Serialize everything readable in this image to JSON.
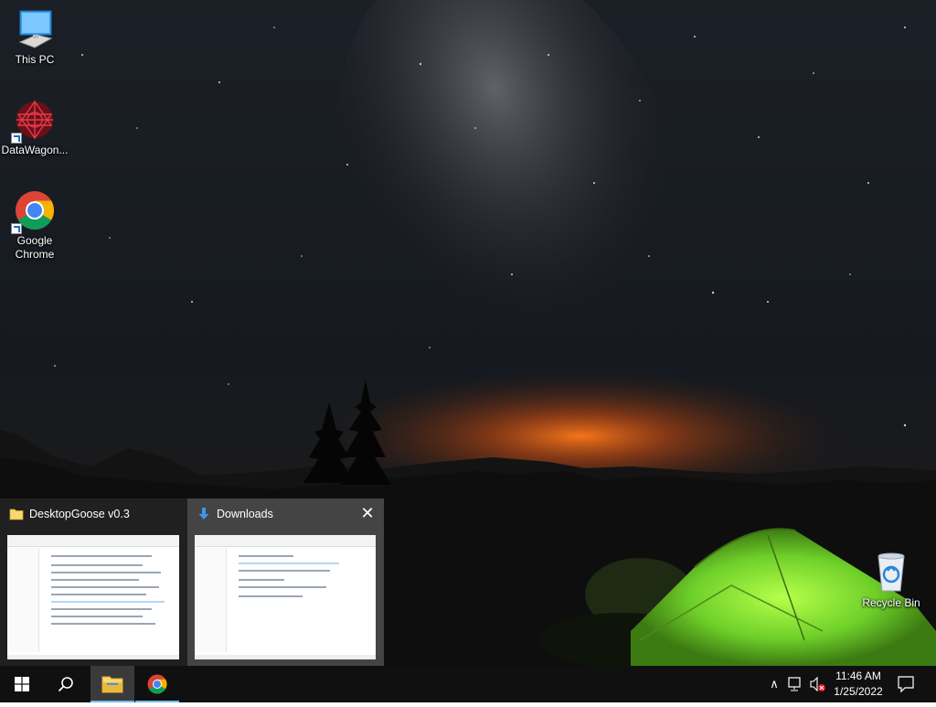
{
  "desktop": {
    "icons": [
      {
        "label": "This PC",
        "icon": "monitor-icon"
      },
      {
        "label": "DataWagon...",
        "icon": "datawagon-icon"
      },
      {
        "label": "Google Chrome",
        "icon": "chrome-icon"
      },
      {
        "label": "Recycle Bin",
        "icon": "recycle-bin-icon"
      }
    ]
  },
  "previews": [
    {
      "title": "DesktopGoose v0.3",
      "icon": "folder-icon"
    },
    {
      "title": "Downloads",
      "icon": "download-arrow-icon",
      "close": "✕"
    }
  ],
  "taskbar": {
    "buttons": [
      {
        "name": "start",
        "icon": "windows-logo-icon"
      },
      {
        "name": "search",
        "icon": "search-icon"
      },
      {
        "name": "file-explorer",
        "icon": "folder-icon",
        "state": "active"
      },
      {
        "name": "chrome",
        "icon": "chrome-icon",
        "state": "open"
      }
    ],
    "tray": {
      "chevron": "∧",
      "icons": [
        "network-icon",
        "volume-muted-icon",
        "notification-icon"
      ]
    },
    "clock": {
      "time": "11:46 AM",
      "date": "1/25/2022"
    }
  },
  "colors": {
    "taskbar": "#101010",
    "accent": "#76b9ed",
    "tent": "#8fe63a"
  }
}
